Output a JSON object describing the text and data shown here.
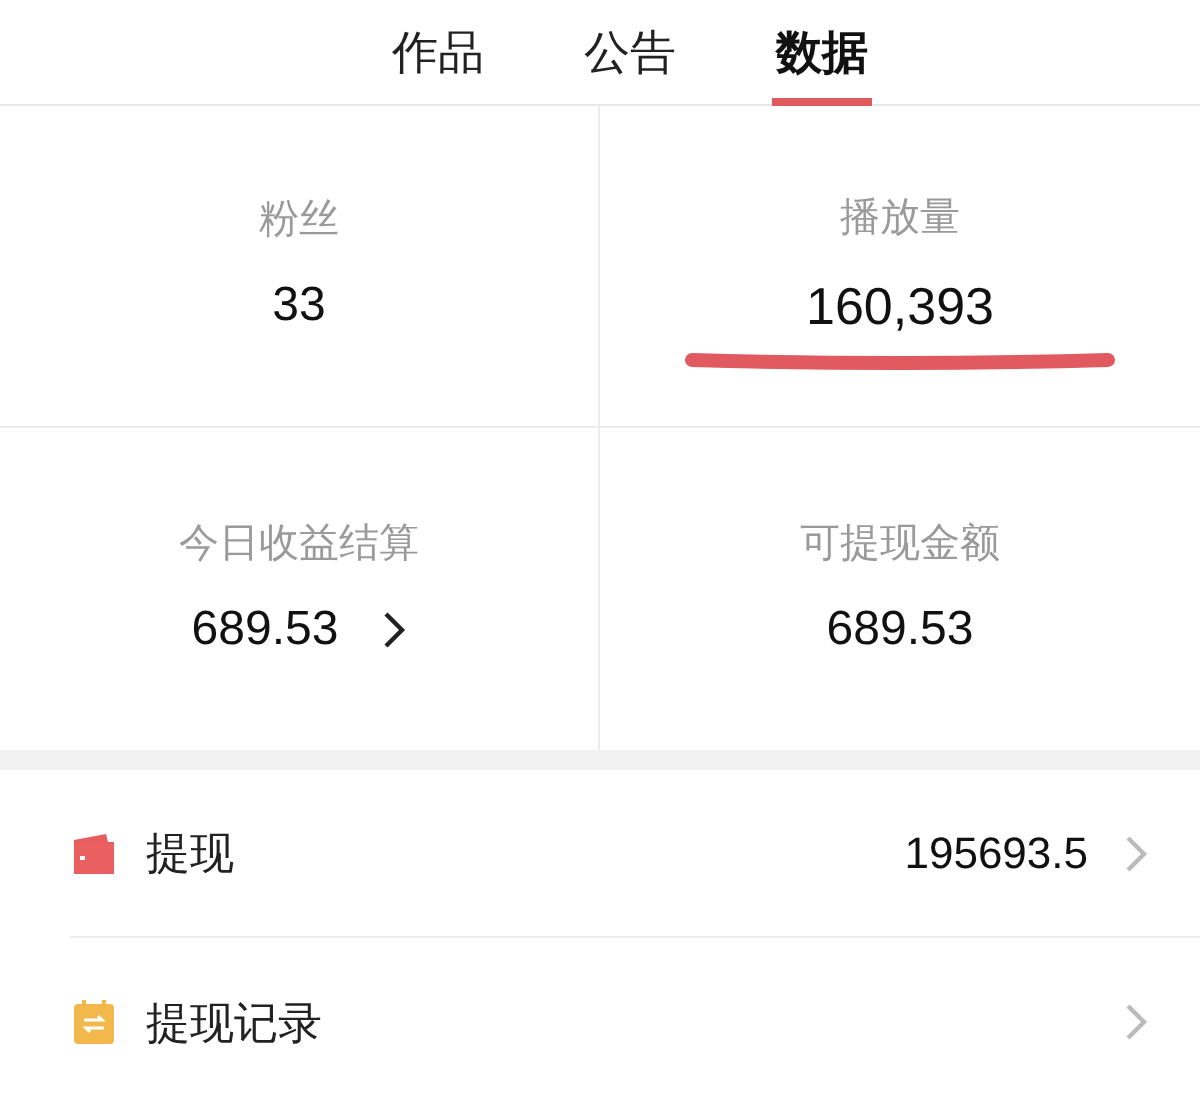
{
  "tabs": [
    {
      "label": "作品",
      "selected": false
    },
    {
      "label": "公告",
      "selected": false
    },
    {
      "label": "数据",
      "selected": true
    }
  ],
  "stats": [
    {
      "label": "粉丝",
      "value": "33",
      "chevron": false,
      "highlighted": false
    },
    {
      "label": "播放量",
      "value": "160,393",
      "chevron": false,
      "highlighted": true
    },
    {
      "label": "今日收益结算",
      "value": "689.53",
      "chevron": true,
      "highlighted": false
    },
    {
      "label": "可提现金额",
      "value": "689.53",
      "chevron": false,
      "highlighted": false
    }
  ],
  "menu": [
    {
      "kind": "wallet",
      "label": "提现",
      "value": "195693.5"
    },
    {
      "kind": "record",
      "label": "提现记录"
    }
  ]
}
